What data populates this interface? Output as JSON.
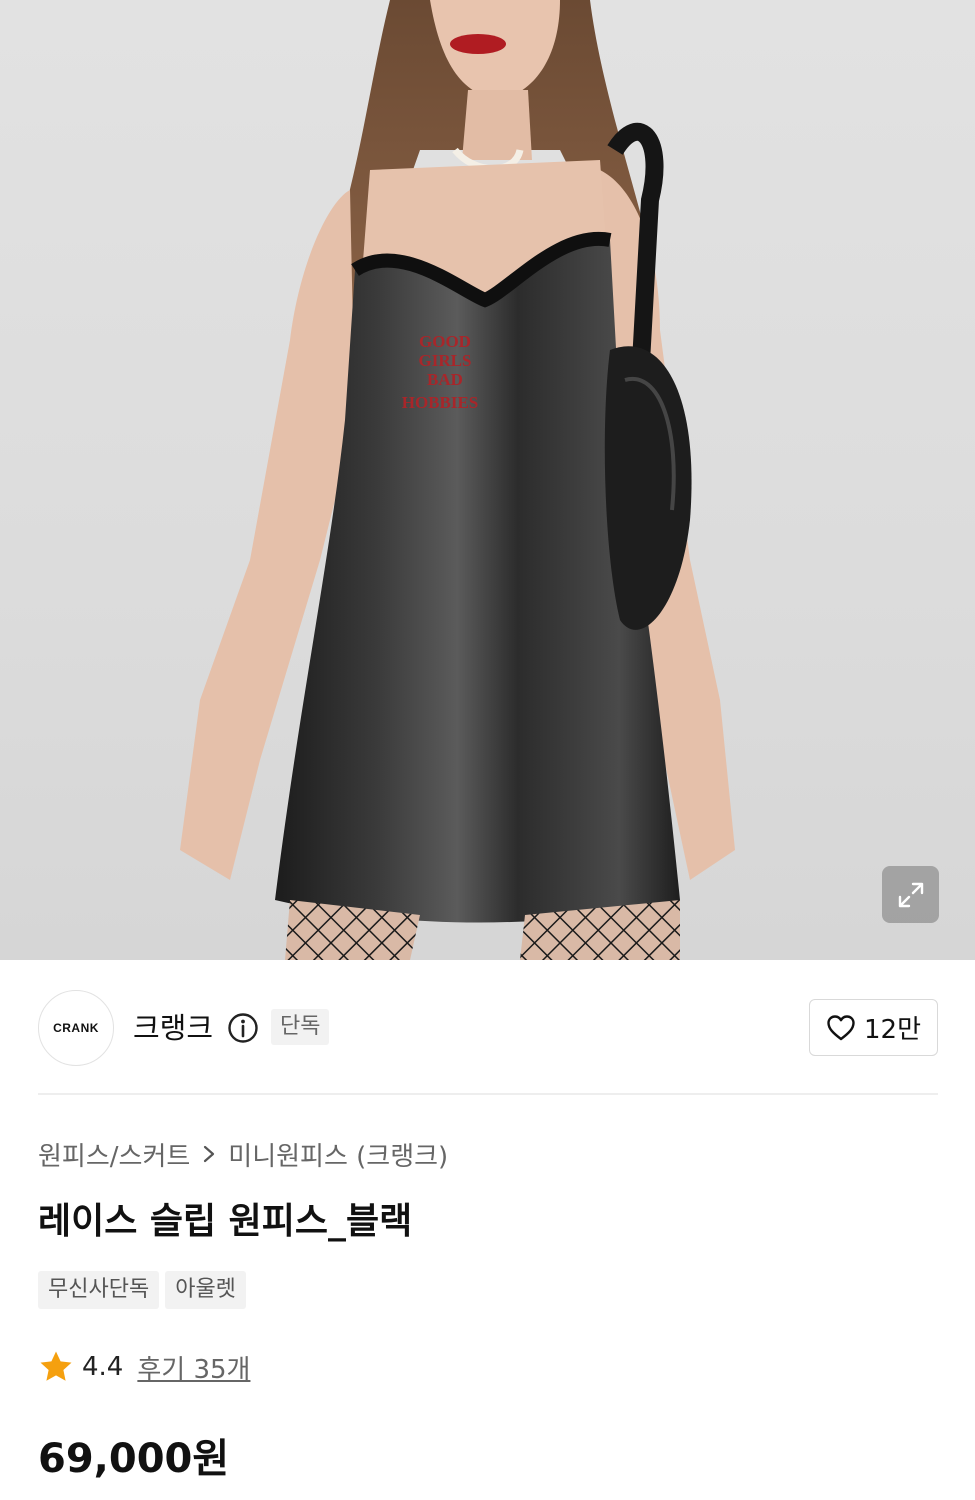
{
  "product_image": {
    "alt": "black satin slip dress with lace trim",
    "embroidery_lines": [
      "GOOD",
      "GIRLS",
      "BAD",
      "HOBBIES"
    ]
  },
  "expand_icon": "expand-diagonal-icon",
  "brand": {
    "logo_text": "CRANK",
    "name": "크랭크",
    "exclusive_badge": "단독",
    "like_count": "12만"
  },
  "breadcrumb": {
    "category": "원피스/스커트",
    "subcategory": "미니원피스 (크랭크)"
  },
  "product": {
    "title": "레이스 슬립 원피스_블랙",
    "tags": [
      "무신사단독",
      "아울렛"
    ],
    "rating": "4.4",
    "reviews": "후기 35개",
    "price": "69,000원"
  },
  "colors": {
    "star": "#F5A00F",
    "text": "#111111",
    "muted": "#666666",
    "tag_bg": "#F2F2F2"
  }
}
